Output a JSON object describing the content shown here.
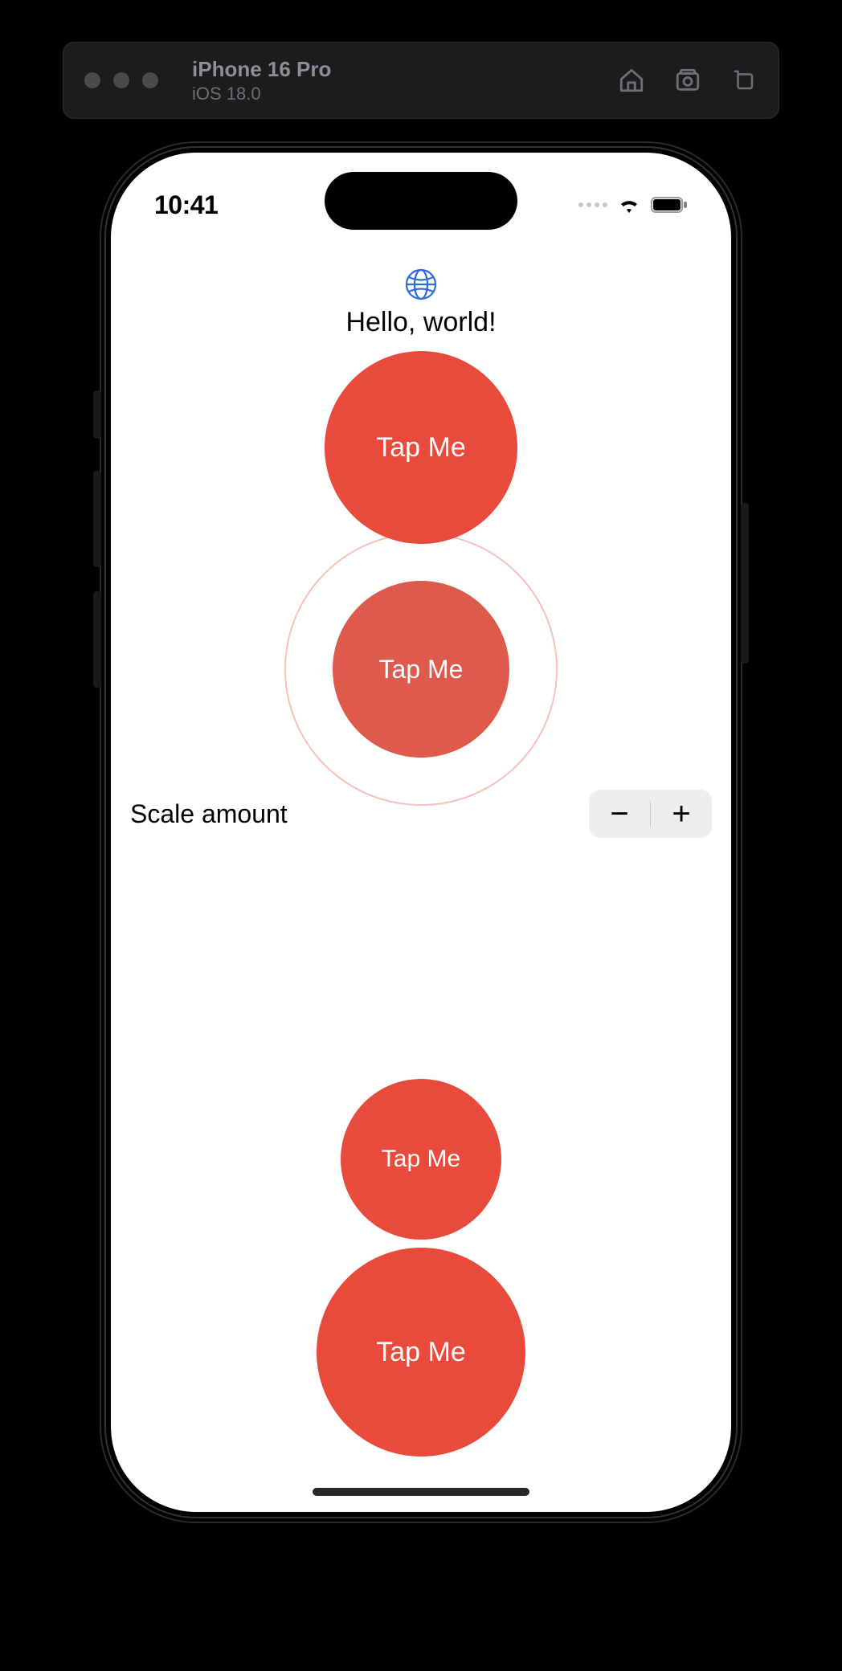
{
  "simulator": {
    "device": "iPhone 16 Pro",
    "os": "iOS 18.0"
  },
  "status_bar": {
    "time": "10:41"
  },
  "app": {
    "greeting": "Hello, world!",
    "buttons": {
      "tap1": "Tap Me",
      "tap2": "Tap Me",
      "tap3": "Tap Me",
      "tap4": "Tap Me"
    },
    "stepper": {
      "label": "Scale amount",
      "minus": "−",
      "plus": "+"
    }
  },
  "colors": {
    "accent": "#e84b3c",
    "globe": "#2b6be4"
  }
}
